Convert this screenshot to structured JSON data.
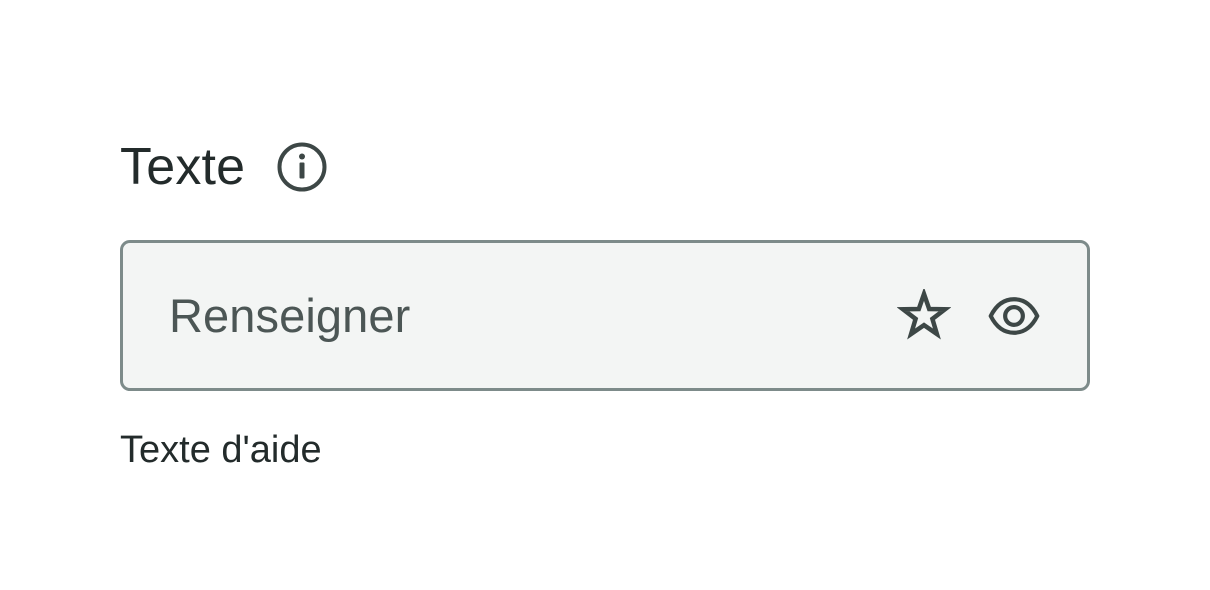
{
  "field": {
    "label": "Texte",
    "label_icon": "info-icon",
    "input": {
      "value": "Renseigner",
      "icons": [
        "star-icon",
        "eye-icon"
      ]
    },
    "helper": "Texte d'aide"
  },
  "colors": {
    "text": "#232b2b",
    "input_text": "#4c5655",
    "input_border": "#7d8b8a",
    "input_background": "#f3f5f4",
    "icon": "#3d4746"
  }
}
